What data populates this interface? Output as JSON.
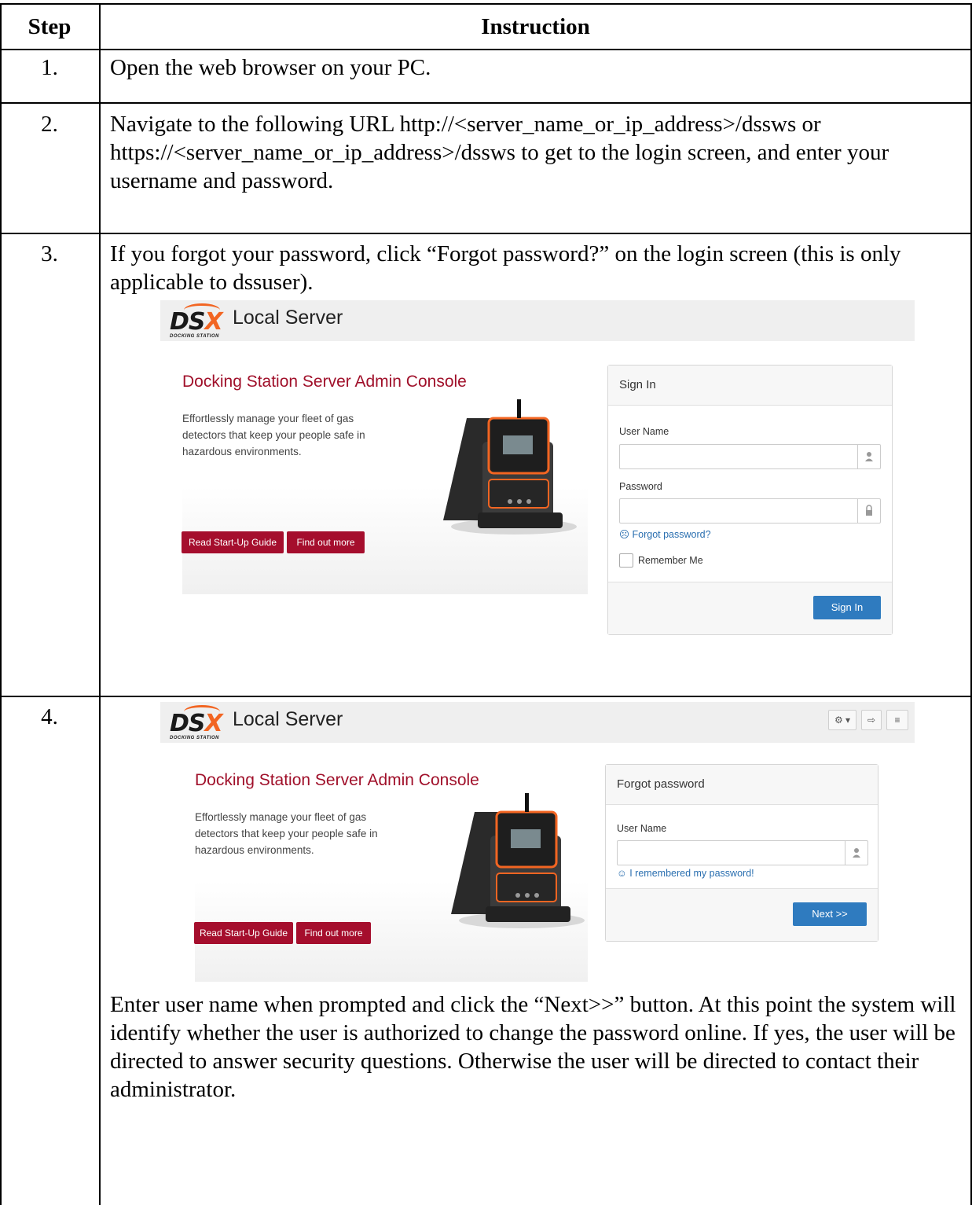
{
  "table": {
    "header_step": "Step",
    "header_instruction": "Instruction"
  },
  "rows": [
    {
      "step": "1.",
      "text": "Open the web browser on your PC."
    },
    {
      "step": "2.",
      "text": "Navigate to the following URL http://<server_name_or_ip_address>/dssws or https://<server_name_or_ip_address>/dssws to get to the login screen, and enter your username and password."
    },
    {
      "step": "3.",
      "text": "If you forgot your password, click “Forgot password?” on the login screen (this is only applicable to dssuser)."
    },
    {
      "step": "4.",
      "text": "Enter user name when prompted and click the “Next>>” button. At this point the system will identify whether the user is authorized to change the password online. If yes, the user will be directed to answer security questions. Otherwise the user will be directed to contact their administrator."
    }
  ],
  "app": {
    "logo_text": "DSX",
    "logo_subtext": "DOCKING STATION",
    "app_name": "Local Server",
    "hero_title": "Docking Station Server Admin Console",
    "hero_desc": "Effortlessly manage your fleet of gas detectors that keep your people safe in hazardous environments.",
    "btn_guide": "Read Start-Up Guide",
    "btn_more": "Find out more"
  },
  "signin": {
    "title": "Sign In",
    "user_label": "User Name",
    "pass_label": "Password",
    "forgot_link": "☹ Forgot password?",
    "remember_label": "Remember Me",
    "submit": "Sign In"
  },
  "forgot": {
    "title": "Forgot password",
    "user_label": "User Name",
    "remembered_link": "☺ I remembered my password!",
    "next": "Next >>"
  },
  "toolbar": {
    "settings": "⚙ ▾",
    "logout": "⇨",
    "menu": "≡"
  },
  "icons": {
    "user": "user-icon",
    "lock": "lock-icon"
  }
}
